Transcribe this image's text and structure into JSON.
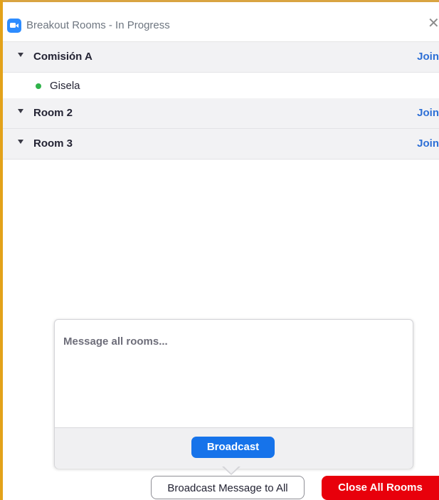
{
  "window": {
    "title": "Breakout Rooms - In Progress",
    "close_icon": "close-icon",
    "app_icon": "zoom-camera-icon"
  },
  "rooms": [
    {
      "name": "Comisión A",
      "join_label": "Join",
      "expanded": true,
      "participants": [
        {
          "name": "Gisela",
          "status_color": "#2fb34a"
        }
      ]
    },
    {
      "name": "Room 2",
      "join_label": "Join",
      "expanded": false,
      "participants": []
    },
    {
      "name": "Room 3",
      "join_label": "Join",
      "expanded": false,
      "participants": []
    }
  ],
  "broadcast_popover": {
    "placeholder": "Message all rooms...",
    "broadcast_label": "Broadcast"
  },
  "footer": {
    "broadcast_all_label": "Broadcast Message to All",
    "close_all_label": "Close All Rooms"
  },
  "colors": {
    "accent_blue": "#1673ea",
    "join_blue": "#2d6fd6",
    "danger_red": "#e8000b",
    "window_border": "#e3a21a"
  }
}
